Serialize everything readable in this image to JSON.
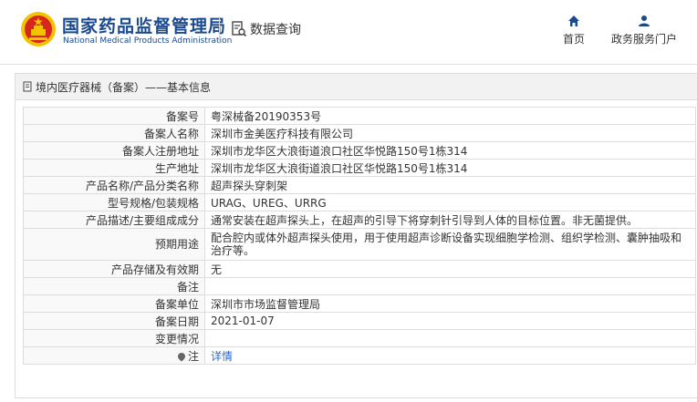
{
  "header": {
    "brand_cn": "国家药品监督管理局",
    "brand_en": "National Medical Products Administration",
    "query_label": "数据查询",
    "nav": [
      {
        "label": "首页",
        "icon": "home-icon"
      },
      {
        "label": "政务服务门户",
        "icon": "user-icon"
      }
    ]
  },
  "panel": {
    "title": "境内医疗器械（备案）——基本信息"
  },
  "record": {
    "rows": [
      {
        "key": "备案号",
        "value": "粤深械备20190353号"
      },
      {
        "key": "备案人名称",
        "value": "深圳市金美医疗科技有限公司"
      },
      {
        "key": "备案人注册地址",
        "value": "深圳市龙华区大浪街道浪口社区华悦路150号1栋314"
      },
      {
        "key": "生产地址",
        "value": "深圳市龙华区大浪街道浪口社区华悦路150号1栋314"
      },
      {
        "key": "产品名称/产品分类名称",
        "value": "超声探头穿刺架"
      },
      {
        "key": "型号规格/包装规格",
        "value": "URAG、UREG、URRG"
      },
      {
        "key": "产品描述/主要组成成分",
        "value": "通常安装在超声探头上，在超声的引导下将穿刺针引导到人体的目标位置。非无菌提供。"
      },
      {
        "key": "预期用途",
        "value": "配合腔内或体外超声探头使用，用于使用超声诊断设备实现细胞学检测、组织学检测、囊肿抽吸和治疗等。"
      },
      {
        "key": "产品存储及有效期",
        "value": "无"
      },
      {
        "key": "备注",
        "value": ""
      },
      {
        "key": "备案单位",
        "value": "深圳市市场监督管理局"
      },
      {
        "key": "备案日期",
        "value": "2021-01-07"
      },
      {
        "key": "变更情况",
        "value": ""
      }
    ],
    "note_key": "注",
    "note_link": "详情"
  },
  "colors": {
    "brand_blue": "#1b4a8f",
    "link_blue": "#2b6bc4",
    "emblem_red": "#d7261e",
    "emblem_gold": "#f3c300"
  }
}
